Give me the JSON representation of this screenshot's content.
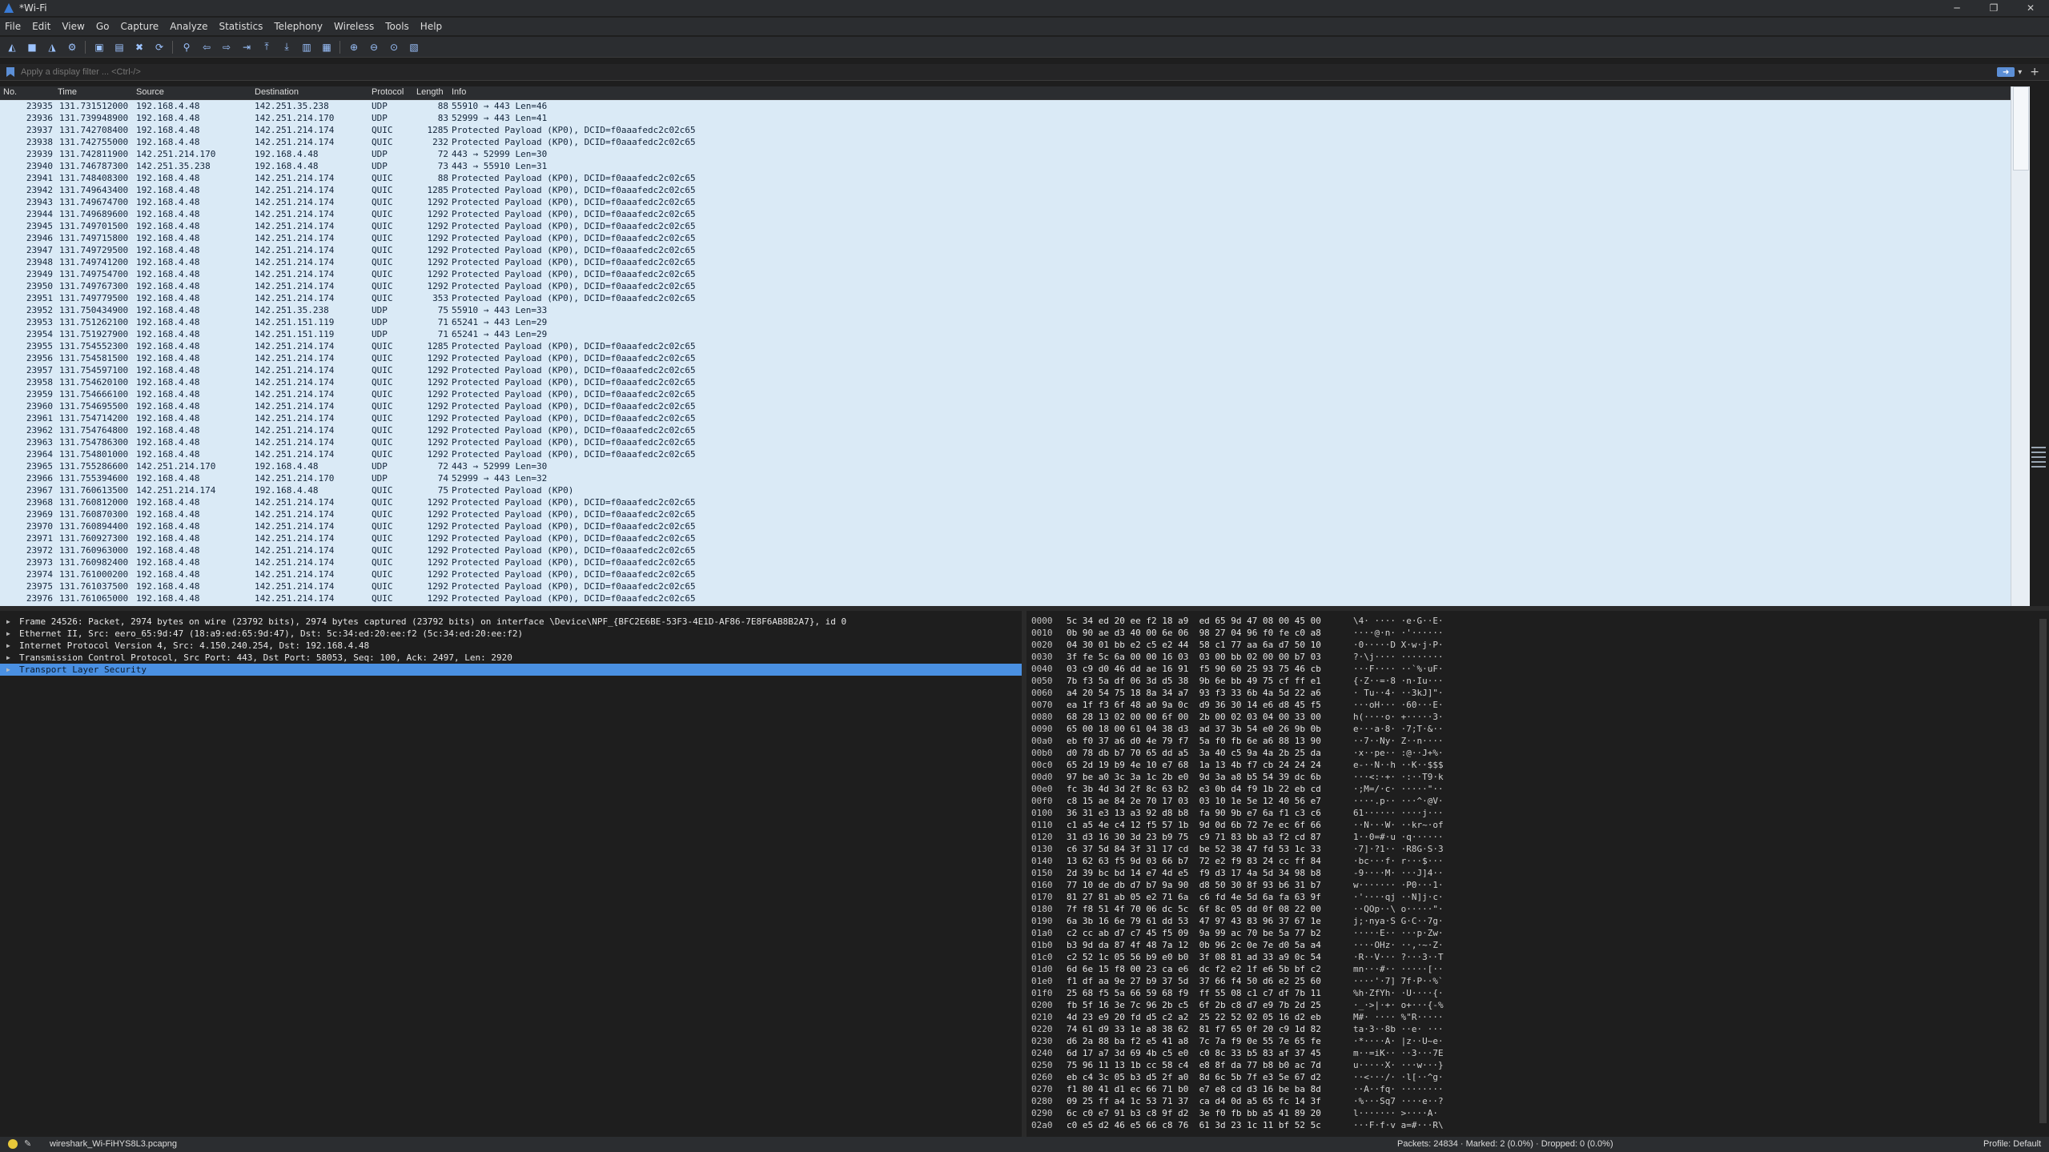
{
  "window": {
    "title": "*Wi-Fi",
    "min": "─",
    "max": "❐",
    "close": "✕"
  },
  "menu": [
    "File",
    "Edit",
    "View",
    "Go",
    "Capture",
    "Analyze",
    "Statistics",
    "Telephony",
    "Wireless",
    "Tools",
    "Help"
  ],
  "toolbar_icons": [
    "shark-fin-start-icon",
    "stop-icon",
    "restart-icon",
    "options-gear-icon",
    "open-folder-icon",
    "save-icon",
    "close-file-icon",
    "reload-icon",
    "find-icon",
    "back-arrow-icon",
    "forward-arrow-icon",
    "go-to-packet-icon",
    "first-packet-icon",
    "last-packet-icon",
    "autoscroll-icon",
    "colorize-icon",
    "zoom-in-icon",
    "zoom-out-icon",
    "normal-size-icon",
    "resize-columns-icon"
  ],
  "filter": {
    "placeholder": "Apply a display filter ... <Ctrl-/>"
  },
  "columns": {
    "no": "No.",
    "time": "Time",
    "source": "Source",
    "destination": "Destination",
    "protocol": "Protocol",
    "length": "Length",
    "info": "Info"
  },
  "packets": [
    [
      "23935",
      "131.731512000",
      "192.168.4.48",
      "142.251.35.238",
      "UDP",
      "88",
      "55910 → 443 Len=46"
    ],
    [
      "23936",
      "131.739948900",
      "192.168.4.48",
      "142.251.214.170",
      "UDP",
      "83",
      "52999 → 443 Len=41"
    ],
    [
      "23937",
      "131.742708400",
      "192.168.4.48",
      "142.251.214.174",
      "QUIC",
      "1285",
      "Protected Payload (KP0), DCID=f0aaafedc2c02c65"
    ],
    [
      "23938",
      "131.742755000",
      "192.168.4.48",
      "142.251.214.174",
      "QUIC",
      "232",
      "Protected Payload (KP0), DCID=f0aaafedc2c02c65"
    ],
    [
      "23939",
      "131.742811900",
      "142.251.214.170",
      "192.168.4.48",
      "UDP",
      "72",
      "443 → 52999 Len=30"
    ],
    [
      "23940",
      "131.746787300",
      "142.251.35.238",
      "192.168.4.48",
      "UDP",
      "73",
      "443 → 55910 Len=31"
    ],
    [
      "23941",
      "131.748408300",
      "192.168.4.48",
      "142.251.214.174",
      "QUIC",
      "88",
      "Protected Payload (KP0), DCID=f0aaafedc2c02c65"
    ],
    [
      "23942",
      "131.749643400",
      "192.168.4.48",
      "142.251.214.174",
      "QUIC",
      "1285",
      "Protected Payload (KP0), DCID=f0aaafedc2c02c65"
    ],
    [
      "23943",
      "131.749674700",
      "192.168.4.48",
      "142.251.214.174",
      "QUIC",
      "1292",
      "Protected Payload (KP0), DCID=f0aaafedc2c02c65"
    ],
    [
      "23944",
      "131.749689600",
      "192.168.4.48",
      "142.251.214.174",
      "QUIC",
      "1292",
      "Protected Payload (KP0), DCID=f0aaafedc2c02c65"
    ],
    [
      "23945",
      "131.749701500",
      "192.168.4.48",
      "142.251.214.174",
      "QUIC",
      "1292",
      "Protected Payload (KP0), DCID=f0aaafedc2c02c65"
    ],
    [
      "23946",
      "131.749715800",
      "192.168.4.48",
      "142.251.214.174",
      "QUIC",
      "1292",
      "Protected Payload (KP0), DCID=f0aaafedc2c02c65"
    ],
    [
      "23947",
      "131.749729500",
      "192.168.4.48",
      "142.251.214.174",
      "QUIC",
      "1292",
      "Protected Payload (KP0), DCID=f0aaafedc2c02c65"
    ],
    [
      "23948",
      "131.749741200",
      "192.168.4.48",
      "142.251.214.174",
      "QUIC",
      "1292",
      "Protected Payload (KP0), DCID=f0aaafedc2c02c65"
    ],
    [
      "23949",
      "131.749754700",
      "192.168.4.48",
      "142.251.214.174",
      "QUIC",
      "1292",
      "Protected Payload (KP0), DCID=f0aaafedc2c02c65"
    ],
    [
      "23950",
      "131.749767300",
      "192.168.4.48",
      "142.251.214.174",
      "QUIC",
      "1292",
      "Protected Payload (KP0), DCID=f0aaafedc2c02c65"
    ],
    [
      "23951",
      "131.749779500",
      "192.168.4.48",
      "142.251.214.174",
      "QUIC",
      "353",
      "Protected Payload (KP0), DCID=f0aaafedc2c02c65"
    ],
    [
      "23952",
      "131.750434900",
      "192.168.4.48",
      "142.251.35.238",
      "UDP",
      "75",
      "55910 → 443 Len=33"
    ],
    [
      "23953",
      "131.751262100",
      "192.168.4.48",
      "142.251.151.119",
      "UDP",
      "71",
      "65241 → 443 Len=29"
    ],
    [
      "23954",
      "131.751927900",
      "192.168.4.48",
      "142.251.151.119",
      "UDP",
      "71",
      "65241 → 443 Len=29"
    ],
    [
      "23955",
      "131.754552300",
      "192.168.4.48",
      "142.251.214.174",
      "QUIC",
      "1285",
      "Protected Payload (KP0), DCID=f0aaafedc2c02c65"
    ],
    [
      "23956",
      "131.754581500",
      "192.168.4.48",
      "142.251.214.174",
      "QUIC",
      "1292",
      "Protected Payload (KP0), DCID=f0aaafedc2c02c65"
    ],
    [
      "23957",
      "131.754597100",
      "192.168.4.48",
      "142.251.214.174",
      "QUIC",
      "1292",
      "Protected Payload (KP0), DCID=f0aaafedc2c02c65"
    ],
    [
      "23958",
      "131.754620100",
      "192.168.4.48",
      "142.251.214.174",
      "QUIC",
      "1292",
      "Protected Payload (KP0), DCID=f0aaafedc2c02c65"
    ],
    [
      "23959",
      "131.754666100",
      "192.168.4.48",
      "142.251.214.174",
      "QUIC",
      "1292",
      "Protected Payload (KP0), DCID=f0aaafedc2c02c65"
    ],
    [
      "23960",
      "131.754695500",
      "192.168.4.48",
      "142.251.214.174",
      "QUIC",
      "1292",
      "Protected Payload (KP0), DCID=f0aaafedc2c02c65"
    ],
    [
      "23961",
      "131.754714200",
      "192.168.4.48",
      "142.251.214.174",
      "QUIC",
      "1292",
      "Protected Payload (KP0), DCID=f0aaafedc2c02c65"
    ],
    [
      "23962",
      "131.754764800",
      "192.168.4.48",
      "142.251.214.174",
      "QUIC",
      "1292",
      "Protected Payload (KP0), DCID=f0aaafedc2c02c65"
    ],
    [
      "23963",
      "131.754786300",
      "192.168.4.48",
      "142.251.214.174",
      "QUIC",
      "1292",
      "Protected Payload (KP0), DCID=f0aaafedc2c02c65"
    ],
    [
      "23964",
      "131.754801000",
      "192.168.4.48",
      "142.251.214.174",
      "QUIC",
      "1292",
      "Protected Payload (KP0), DCID=f0aaafedc2c02c65"
    ],
    [
      "23965",
      "131.755286600",
      "142.251.214.170",
      "192.168.4.48",
      "UDP",
      "72",
      "443 → 52999 Len=30"
    ],
    [
      "23966",
      "131.755394600",
      "192.168.4.48",
      "142.251.214.170",
      "UDP",
      "74",
      "52999 → 443 Len=32"
    ],
    [
      "23967",
      "131.760613500",
      "142.251.214.174",
      "192.168.4.48",
      "QUIC",
      "75",
      "Protected Payload (KP0)"
    ],
    [
      "23968",
      "131.760812000",
      "192.168.4.48",
      "142.251.214.174",
      "QUIC",
      "1292",
      "Protected Payload (KP0), DCID=f0aaafedc2c02c65"
    ],
    [
      "23969",
      "131.760870300",
      "192.168.4.48",
      "142.251.214.174",
      "QUIC",
      "1292",
      "Protected Payload (KP0), DCID=f0aaafedc2c02c65"
    ],
    [
      "23970",
      "131.760894400",
      "192.168.4.48",
      "142.251.214.174",
      "QUIC",
      "1292",
      "Protected Payload (KP0), DCID=f0aaafedc2c02c65"
    ],
    [
      "23971",
      "131.760927300",
      "192.168.4.48",
      "142.251.214.174",
      "QUIC",
      "1292",
      "Protected Payload (KP0), DCID=f0aaafedc2c02c65"
    ],
    [
      "23972",
      "131.760963000",
      "192.168.4.48",
      "142.251.214.174",
      "QUIC",
      "1292",
      "Protected Payload (KP0), DCID=f0aaafedc2c02c65"
    ],
    [
      "23973",
      "131.760982400",
      "192.168.4.48",
      "142.251.214.174",
      "QUIC",
      "1292",
      "Protected Payload (KP0), DCID=f0aaafedc2c02c65"
    ],
    [
      "23974",
      "131.761000200",
      "192.168.4.48",
      "142.251.214.174",
      "QUIC",
      "1292",
      "Protected Payload (KP0), DCID=f0aaafedc2c02c65"
    ],
    [
      "23975",
      "131.761037500",
      "192.168.4.48",
      "142.251.214.174",
      "QUIC",
      "1292",
      "Protected Payload (KP0), DCID=f0aaafedc2c02c65"
    ],
    [
      "23976",
      "131.761065000",
      "192.168.4.48",
      "142.251.214.174",
      "QUIC",
      "1292",
      "Protected Payload (KP0), DCID=f0aaafedc2c02c65"
    ]
  ],
  "details": [
    {
      "text": "Frame 24526: Packet, 2974 bytes on wire (23792 bits), 2974 bytes captured (23792 bits) on interface \\Device\\NPF_{BFC2E6BE-53F3-4E1D-AF86-7E8F6AB8B2A7}, id 0",
      "selected": false
    },
    {
      "text": "Ethernet II, Src: eero_65:9d:47 (18:a9:ed:65:9d:47), Dst: 5c:34:ed:20:ee:f2 (5c:34:ed:20:ee:f2)",
      "selected": false
    },
    {
      "text": "Internet Protocol Version 4, Src: 4.150.240.254, Dst: 192.168.4.48",
      "selected": false
    },
    {
      "text": "Transmission Control Protocol, Src Port: 443, Dst Port: 58053, Seq: 100, Ack: 2497, Len: 2920",
      "selected": false
    },
    {
      "text": "Transport Layer Security",
      "selected": true
    }
  ],
  "hexdump": [
    [
      "0000",
      "5c 34 ed 20 ee f2 18 a9  ed 65 9d 47 08 00 45 00",
      "\\4· ···· ·e·G··E·"
    ],
    [
      "0010",
      "0b 90 ae d3 40 00 6e 06  98 27 04 96 f0 fe c0 a8",
      "····@·n· ·'······"
    ],
    [
      "0020",
      "04 30 01 bb e2 c5 e2 44  58 c1 77 aa 6a d7 50 10",
      "·0·····D X·w·j·P·"
    ],
    [
      "0030",
      "3f fe 5c 6a 00 00 16 03  03 00 bb 02 00 00 b7 03",
      "?·\\j···· ········"
    ],
    [
      "0040",
      "03 c9 d0 46 dd ae 16 91  f5 90 60 25 93 75 46 cb",
      "···F···· ··`%·uF·"
    ],
    [
      "0050",
      "7b f3 5a df 06 3d d5 38  9b 6e bb 49 75 cf ff e1",
      "{·Z··=·8 ·n·Iu···"
    ],
    [
      "0060",
      "a4 20 54 75 18 8a 34 a7  93 f3 33 6b 4a 5d 22 a6",
      "· Tu··4· ··3kJ]\"·"
    ],
    [
      "0070",
      "ea 1f f3 6f 48 a0 9a 0c  d9 36 30 14 e6 d8 45 f5",
      "···oH··· ·60···E·"
    ],
    [
      "0080",
      "68 28 13 02 00 00 6f 00  2b 00 02 03 04 00 33 00",
      "h(····o· +·····3·"
    ],
    [
      "0090",
      "65 00 18 00 61 04 38 d3  ad 37 3b 54 e0 26 9b 0b",
      "e···a·8· ·7;T·&··"
    ],
    [
      "00a0",
      "eb f0 37 a6 d0 4e 79 f7  5a f0 fb 6e a6 88 13 90",
      "··7··Ny· Z··n····"
    ],
    [
      "00b0",
      "d0 78 db b7 70 65 dd a5  3a 40 c5 9a 4a 2b 25 da",
      "·x··pe·· :@··J+%·"
    ],
    [
      "00c0",
      "65 2d 19 b9 4e 10 e7 68  1a 13 4b f7 cb 24 24 24",
      "e-··N··h ··K··$$$"
    ],
    [
      "00d0",
      "97 be a0 3c 3a 1c 2b e0  9d 3a a8 b5 54 39 dc 6b",
      "···<:·+· ·:··T9·k"
    ],
    [
      "00e0",
      "fc 3b 4d 3d 2f 8c 63 b2  e3 0b d4 f9 1b 22 eb cd",
      "·;M=/·c· ·····\"··"
    ],
    [
      "00f0",
      "c8 15 ae 84 2e 70 17 03  03 10 1e 5e 12 40 56 e7",
      "····.p·· ···^·@V·"
    ],
    [
      "0100",
      "36 31 e3 13 a3 92 d8 b8  fa 90 9b e7 6a f1 c3 c6",
      "61······ ····j···"
    ],
    [
      "0110",
      "c1 a5 4e c4 12 f5 57 1b  9d 0d 6b 72 7e ec 6f 66",
      "··N···W· ··kr~·of"
    ],
    [
      "0120",
      "31 d3 16 30 3d 23 b9 75  c9 71 83 bb a3 f2 cd 87",
      "1··0=#·u ·q······"
    ],
    [
      "0130",
      "c6 37 5d 84 3f 31 17 cd  be 52 38 47 fd 53 1c 33",
      "·7]·?1·· ·R8G·S·3"
    ],
    [
      "0140",
      "13 62 63 f5 9d 03 66 b7  72 e2 f9 83 24 cc ff 84",
      "·bc···f· r···$···"
    ],
    [
      "0150",
      "2d 39 bc bd 14 e7 4d e5  f9 d3 17 4a 5d 34 98 b8",
      "-9····M· ···J]4··"
    ],
    [
      "0160",
      "77 10 de db d7 b7 9a 90  d8 50 30 8f 93 b6 31 b7",
      "w······· ·P0···1·"
    ],
    [
      "0170",
      "81 27 81 ab 05 e2 71 6a  c6 fd 4e 5d 6a fa 63 9f",
      "·'····qj ··N]j·c·"
    ],
    [
      "0180",
      "7f f8 51 4f 70 06 dc 5c  6f 8c 05 dd 0f 08 22 00",
      "··QOp··\\ o·····\"·"
    ],
    [
      "0190",
      "6a 3b 16 6e 79 61 dd 53  47 97 43 83 96 37 67 1e",
      "j;·nya·S G·C··7g·"
    ],
    [
      "01a0",
      "c2 cc ab d7 c7 45 f5 09  9a 99 ac 70 be 5a 77 b2",
      "·····E·· ···p·Zw·"
    ],
    [
      "01b0",
      "b3 9d da 87 4f 48 7a 12  0b 96 2c 0e 7e d0 5a a4",
      "····OHz· ··,·~·Z·"
    ],
    [
      "01c0",
      "c2 52 1c 05 56 b9 e0 b0  3f 08 81 ad 33 a9 0c 54",
      "·R··V··· ?···3··T"
    ],
    [
      "01d0",
      "6d 6e 15 f8 00 23 ca e6  dc f2 e2 1f e6 5b bf c2",
      "mn···#·· ·····[··"
    ],
    [
      "01e0",
      "f1 df aa 9e 27 b9 37 5d  37 66 f4 50 d6 e2 25 60",
      "····'·7] 7f·P··%`"
    ],
    [
      "01f0",
      "25 68 f5 5a 66 59 68 f9  ff 55 08 c1 c7 df 7b 11",
      "%h·ZfYh· ·U····{·"
    ],
    [
      "0200",
      "fb 5f 16 3e 7c 96 2b c5  6f 2b c8 d7 e9 7b 2d 25",
      "·_·>|·+· o+···{-%"
    ],
    [
      "0210",
      "4d 23 e9 20 fd d5 c2 a2  25 22 52 02 05 16 d2 eb",
      "M#· ···· %\"R·····"
    ],
    [
      "0220",
      "74 61 d9 33 1e a8 38 62  81 f7 65 0f 20 c9 1d 82",
      "ta·3··8b ··e· ···"
    ],
    [
      "0230",
      "d6 2a 88 ba f2 e5 41 a8  7c 7a f9 0e 55 7e 65 fe",
      "·*····A· |z··U~e·"
    ],
    [
      "0240",
      "6d 17 a7 3d 69 4b c5 e0  c0 8c 33 b5 83 af 37 45",
      "m··=iK·· ··3···7E"
    ],
    [
      "0250",
      "75 96 11 13 1b cc 58 c4  e8 8f da 77 b8 b0 ac 7d",
      "u·····X· ···w···}"
    ],
    [
      "0260",
      "eb c4 3c 05 b3 d5 2f a0  8d 6c 5b 7f e3 5e 67 d2",
      "··<···/· ·l[··^g·"
    ],
    [
      "0270",
      "f1 80 41 d1 ec 66 71 b0  e7 e8 cd d3 16 be ba 8d",
      "··A··fq· ········"
    ],
    [
      "0280",
      "09 25 ff a4 1c 53 71 37  ca d4 0d a5 65 fc 14 3f",
      "·%···Sq7 ····e··?"
    ],
    [
      "0290",
      "6c c0 e7 91 b3 c8 9f d2  3e f0 fb bb a5 41 89 20",
      "l······· >····A· "
    ],
    [
      "02a0",
      "c0 e5 d2 46 e5 66 c8 76  61 3d 23 1c 11 bf 52 5c",
      "···F·f·v a=#···R\\"
    ]
  ],
  "status": {
    "file": "wireshark_Wi-FiHYS8L3.pcapng",
    "stats": "Packets: 24834 · Marked: 2 (0.0%) · Dropped: 0 (0.0%)",
    "profile": "Profile: Default"
  }
}
